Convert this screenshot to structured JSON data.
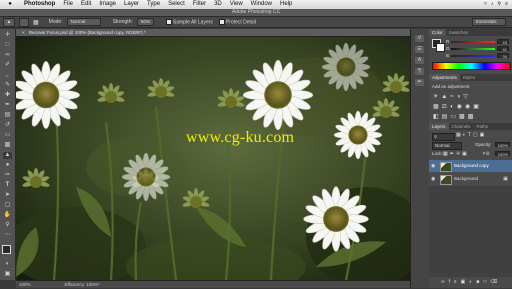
{
  "menubar": {
    "apple": "",
    "app": "Photoshop",
    "items": [
      "File",
      "Edit",
      "Image",
      "Layer",
      "Type",
      "Select",
      "Filter",
      "3D",
      "View",
      "Window",
      "Help"
    ]
  },
  "window": {
    "title": "Adobe Photoshop CC"
  },
  "options": {
    "mode_label": "Mode:",
    "mode_value": "Normal",
    "strength_label": "Strength:",
    "strength_value": "50%",
    "sample_all_layers": "Sample All Layers",
    "protect_detail": "Protect Detail",
    "workspace": "Essentials"
  },
  "document": {
    "tab": "Recover Focus.psd @ 100% (Background copy, RGB/8*) *",
    "watermark": "www.cg-ku.com",
    "zoom": "100%",
    "efficiency": "Efficiency: 100%*"
  },
  "color_panel": {
    "tabs": [
      "Color",
      "Swatches"
    ],
    "r": "43",
    "g": "41",
    "b": "34"
  },
  "adjustments_panel": {
    "tabs": [
      "Adjustments",
      "Styles"
    ],
    "label": "Add an adjustment"
  },
  "layers_panel": {
    "tabs": [
      "Layers",
      "Channels",
      "Paths"
    ],
    "blend_mode": "Normal",
    "opacity_label": "Opacity:",
    "opacity": "100%",
    "lock_label": "Lock:",
    "fill_label": "Fill:",
    "fill": "100%",
    "layers": [
      {
        "name": "Background copy",
        "selected": true
      },
      {
        "name": "Background",
        "selected": false
      }
    ]
  },
  "colors": {
    "accent": "#4a6e96",
    "watermark": "#f0f000"
  }
}
